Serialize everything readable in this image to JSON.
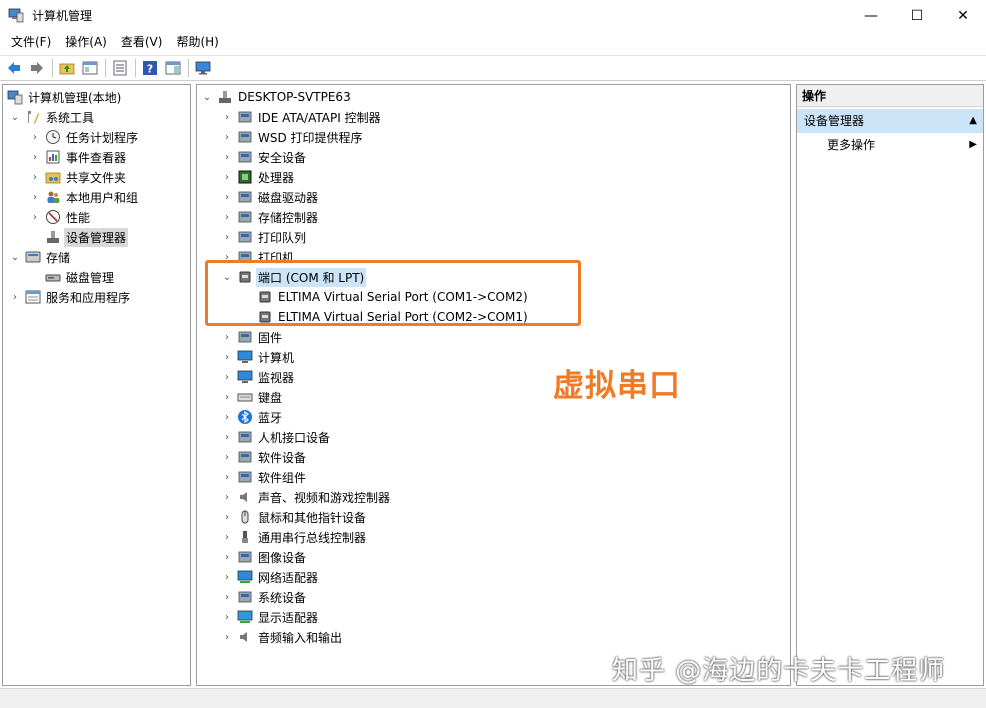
{
  "window": {
    "title": "计算机管理",
    "minimize": "—",
    "maximize": "☐",
    "close": "✕"
  },
  "menu": [
    "文件(F)",
    "操作(A)",
    "查看(V)",
    "帮助(H)"
  ],
  "left_tree": {
    "root": "计算机管理(本地)",
    "system_tools": "系统工具",
    "task_scheduler": "任务计划程序",
    "event_viewer": "事件查看器",
    "shared_folders": "共享文件夹",
    "local_users": "本地用户和组",
    "performance": "性能",
    "device_manager": "设备管理器",
    "storage": "存储",
    "disk_management": "磁盘管理",
    "services": "服务和应用程序"
  },
  "device_tree": {
    "computer": "DESKTOP-SVTPE63",
    "categories": [
      "IDE ATA/ATAPI 控制器",
      "WSD 打印提供程序",
      "安全设备",
      "处理器",
      "磁盘驱动器",
      "存储控制器",
      "打印队列",
      "打印机",
      "端口 (COM 和 LPT)",
      "固件",
      "计算机",
      "监视器",
      "键盘",
      "蓝牙",
      "人机接口设备",
      "软件设备",
      "软件组件",
      "声音、视频和游戏控制器",
      "鼠标和其他指针设备",
      "通用串行总线控制器",
      "图像设备",
      "网络适配器",
      "系统设备",
      "显示适配器",
      "音频输入和输出"
    ],
    "ports": [
      "ELTIMA Virtual Serial Port (COM1->COM2)",
      "ELTIMA Virtual Serial Port (COM2->COM1)"
    ]
  },
  "actions_pane": {
    "header": "操作",
    "section": "设备管理器",
    "more_actions": "更多操作"
  },
  "annotation": {
    "text": "虚拟串口",
    "color": "#f07a26"
  },
  "watermark": "知乎 @海边的卡夫卡工程师"
}
